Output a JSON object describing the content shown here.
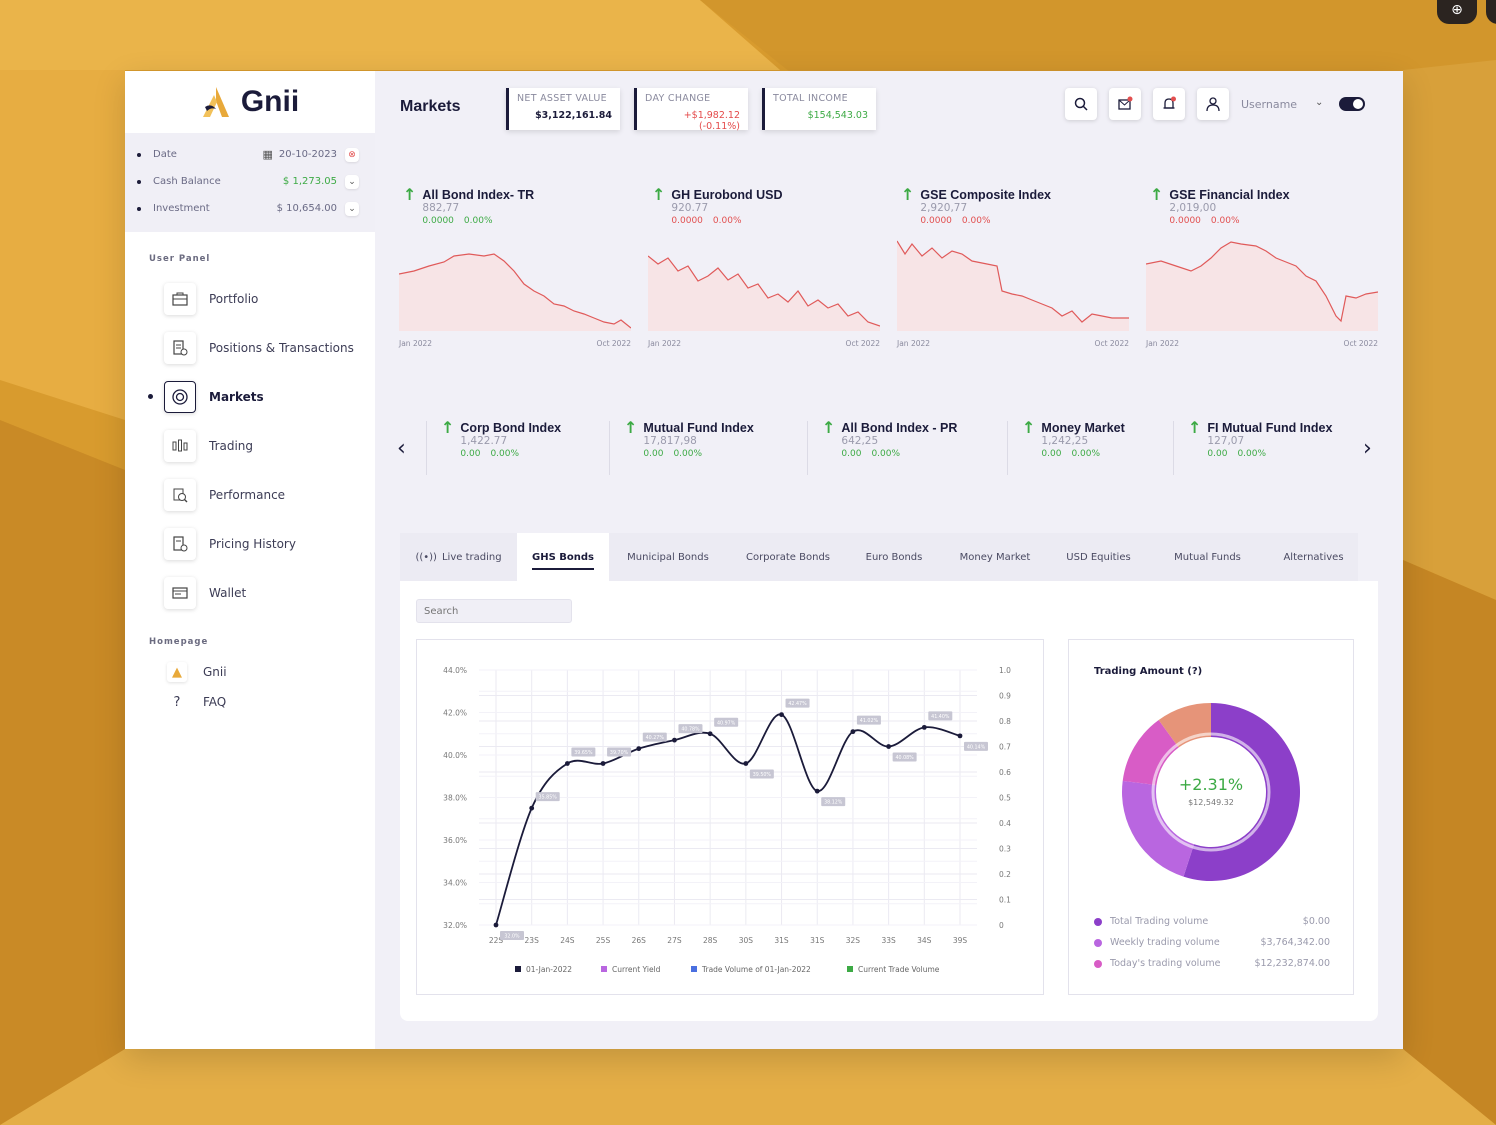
{
  "colors": {
    "accent": "#1b1b3a",
    "green": "#3daa45",
    "red": "#e24f4f",
    "gold": "#e8a93a",
    "donut_purple": "#8c3fc9",
    "donut_light": "#b966e0",
    "donut_pink": "#d85cc6",
    "donut_salmon": "#e69479"
  },
  "app": {
    "name": "Gnii"
  },
  "summary": {
    "date_label": "Date",
    "date_value": "20-10-2023",
    "cash_label": "Cash Balance",
    "cash_value": "$ 1,273.05",
    "invest_label": "Investment",
    "invest_value": "$ 10,654.00"
  },
  "sidebar": {
    "user_panel_label": "User Panel",
    "items": [
      {
        "label": "Portfolio",
        "icon": "briefcase-icon"
      },
      {
        "label": "Positions & Transactions",
        "icon": "document-icon"
      },
      {
        "label": "Markets",
        "icon": "markets-icon"
      },
      {
        "label": "Trading",
        "icon": "candlestick-icon"
      },
      {
        "label": "Performance",
        "icon": "performance-icon"
      },
      {
        "label": "Pricing History",
        "icon": "history-icon"
      },
      {
        "label": "Wallet",
        "icon": "wallet-icon"
      }
    ],
    "homepage_label": "Homepage",
    "home_items": [
      {
        "label": "Gnii"
      },
      {
        "label": "FAQ"
      }
    ]
  },
  "header": {
    "title": "Markets",
    "nav_label": "NET ASSET VALUE",
    "nav_value": "$3,122,161.84",
    "day_label": "DAY CHANGE",
    "day_value": "+$1,982.12 (-0.11%)",
    "income_label": "TOTAL INCOME",
    "income_value": "$154,543.03",
    "username": "Username"
  },
  "indices": [
    {
      "name": "All Bond Index- TR",
      "value": "882,77",
      "chg": "0.0000",
      "pct": "0.00%",
      "start": "Jan 2022",
      "end": "Oct 2022",
      "chg_color": "green"
    },
    {
      "name": "GH Eurobond USD",
      "value": "920.77",
      "chg": "0.0000",
      "pct": "0.00%",
      "start": "Jan 2022",
      "end": "Oct 2022",
      "chg_color": "red"
    },
    {
      "name": "GSE Composite Index",
      "value": "2,920,77",
      "chg": "0.0000",
      "pct": "0.00%",
      "start": "Jan 2022",
      "end": "Oct 2022",
      "chg_color": "red"
    },
    {
      "name": "GSE Financial Index",
      "value": "2,019,00",
      "chg": "0.0000",
      "pct": "0.00%",
      "start": "Jan 2022",
      "end": "Oct 2022",
      "chg_color": "red"
    }
  ],
  "mini_indices": [
    {
      "name": "Corp Bond Index",
      "value": "1,422.77",
      "chg": "0.00",
      "pct": "0.00%"
    },
    {
      "name": "Mutual Fund Index",
      "value": "17,817,98",
      "chg": "0.00",
      "pct": "0.00%"
    },
    {
      "name": "All Bond Index - PR",
      "value": "642,25",
      "chg": "0.00",
      "pct": "0.00%"
    },
    {
      "name": "Money Market",
      "value": "1,242,25",
      "chg": "0.00",
      "pct": "0.00%"
    },
    {
      "name": "FI Mutual Fund Index",
      "value": "127,07",
      "chg": "0.00",
      "pct": "0.00%"
    }
  ],
  "tabs": [
    {
      "label": "Live trading"
    },
    {
      "label": "GHS Bonds"
    },
    {
      "label": "Municipal Bonds"
    },
    {
      "label": "Corporate Bonds"
    },
    {
      "label": "Euro Bonds"
    },
    {
      "label": "Money Market"
    },
    {
      "label": "USD Equities"
    },
    {
      "label": "Mutual Funds"
    },
    {
      "label": "Alternatives"
    }
  ],
  "search": {
    "placeholder": "Search"
  },
  "chart_data": [
    {
      "type": "line",
      "x": [
        "22S",
        "23S",
        "24S",
        "25S",
        "26S",
        "27S",
        "28S",
        "30S",
        "31S",
        "31S",
        "32S",
        "33S",
        "34S",
        "39S"
      ],
      "series": [
        {
          "name": "01-Jan-2022",
          "values": [
            32.0,
            37.5,
            39.6,
            39.6,
            40.3,
            40.7,
            41.0,
            39.6,
            41.9,
            38.3,
            41.1,
            40.4,
            41.3,
            40.9
          ]
        }
      ],
      "point_labels": [
        "32.0%",
        "35.85%",
        "39.65%",
        "39.70%",
        "40.27%",
        "40.78%",
        "40.97%",
        "39.50%",
        "42.47%",
        "38.12%",
        "41.02%",
        "40.08%",
        "41.40%",
        "40.14%"
      ],
      "y_ticks_left": [
        "44.0%",
        "42.0%",
        "40.0%",
        "38.0%",
        "36.0%",
        "34.0%",
        "32.0%"
      ],
      "y_ticks_right": [
        "1.0",
        "0.9",
        "0.8",
        "0.7",
        "0.6",
        "0.5",
        "0.4",
        "0.3",
        "0.2",
        "0.1",
        "0"
      ],
      "ylim": [
        32,
        44
      ],
      "legend": [
        {
          "name": "01-Jan-2022",
          "color": "#1b1b3a"
        },
        {
          "name": "Current Yield",
          "color": "#b966e0"
        },
        {
          "name": "Trade Volume of 01-Jan-2022",
          "color": "#4a6fe0"
        },
        {
          "name": "Current Trade Volume",
          "color": "#3daa45"
        }
      ]
    },
    {
      "type": "pie",
      "title": "Trading Amount (?)",
      "center_value": "+2.31%",
      "center_sub": "$12,549.32",
      "slices": [
        {
          "value": 55
        },
        {
          "value": 22
        },
        {
          "value": 13
        },
        {
          "value": 10
        }
      ],
      "legend": [
        {
          "label": "Total Trading volume",
          "value": "$0.00",
          "color": "#8c3fc9"
        },
        {
          "label": "Weekly trading volume",
          "value": "$3,764,342.00",
          "color": "#b966e0"
        },
        {
          "label": "Today's trading volume",
          "value": "$12,232,874.00",
          "color": "#d85cc6"
        }
      ]
    }
  ]
}
